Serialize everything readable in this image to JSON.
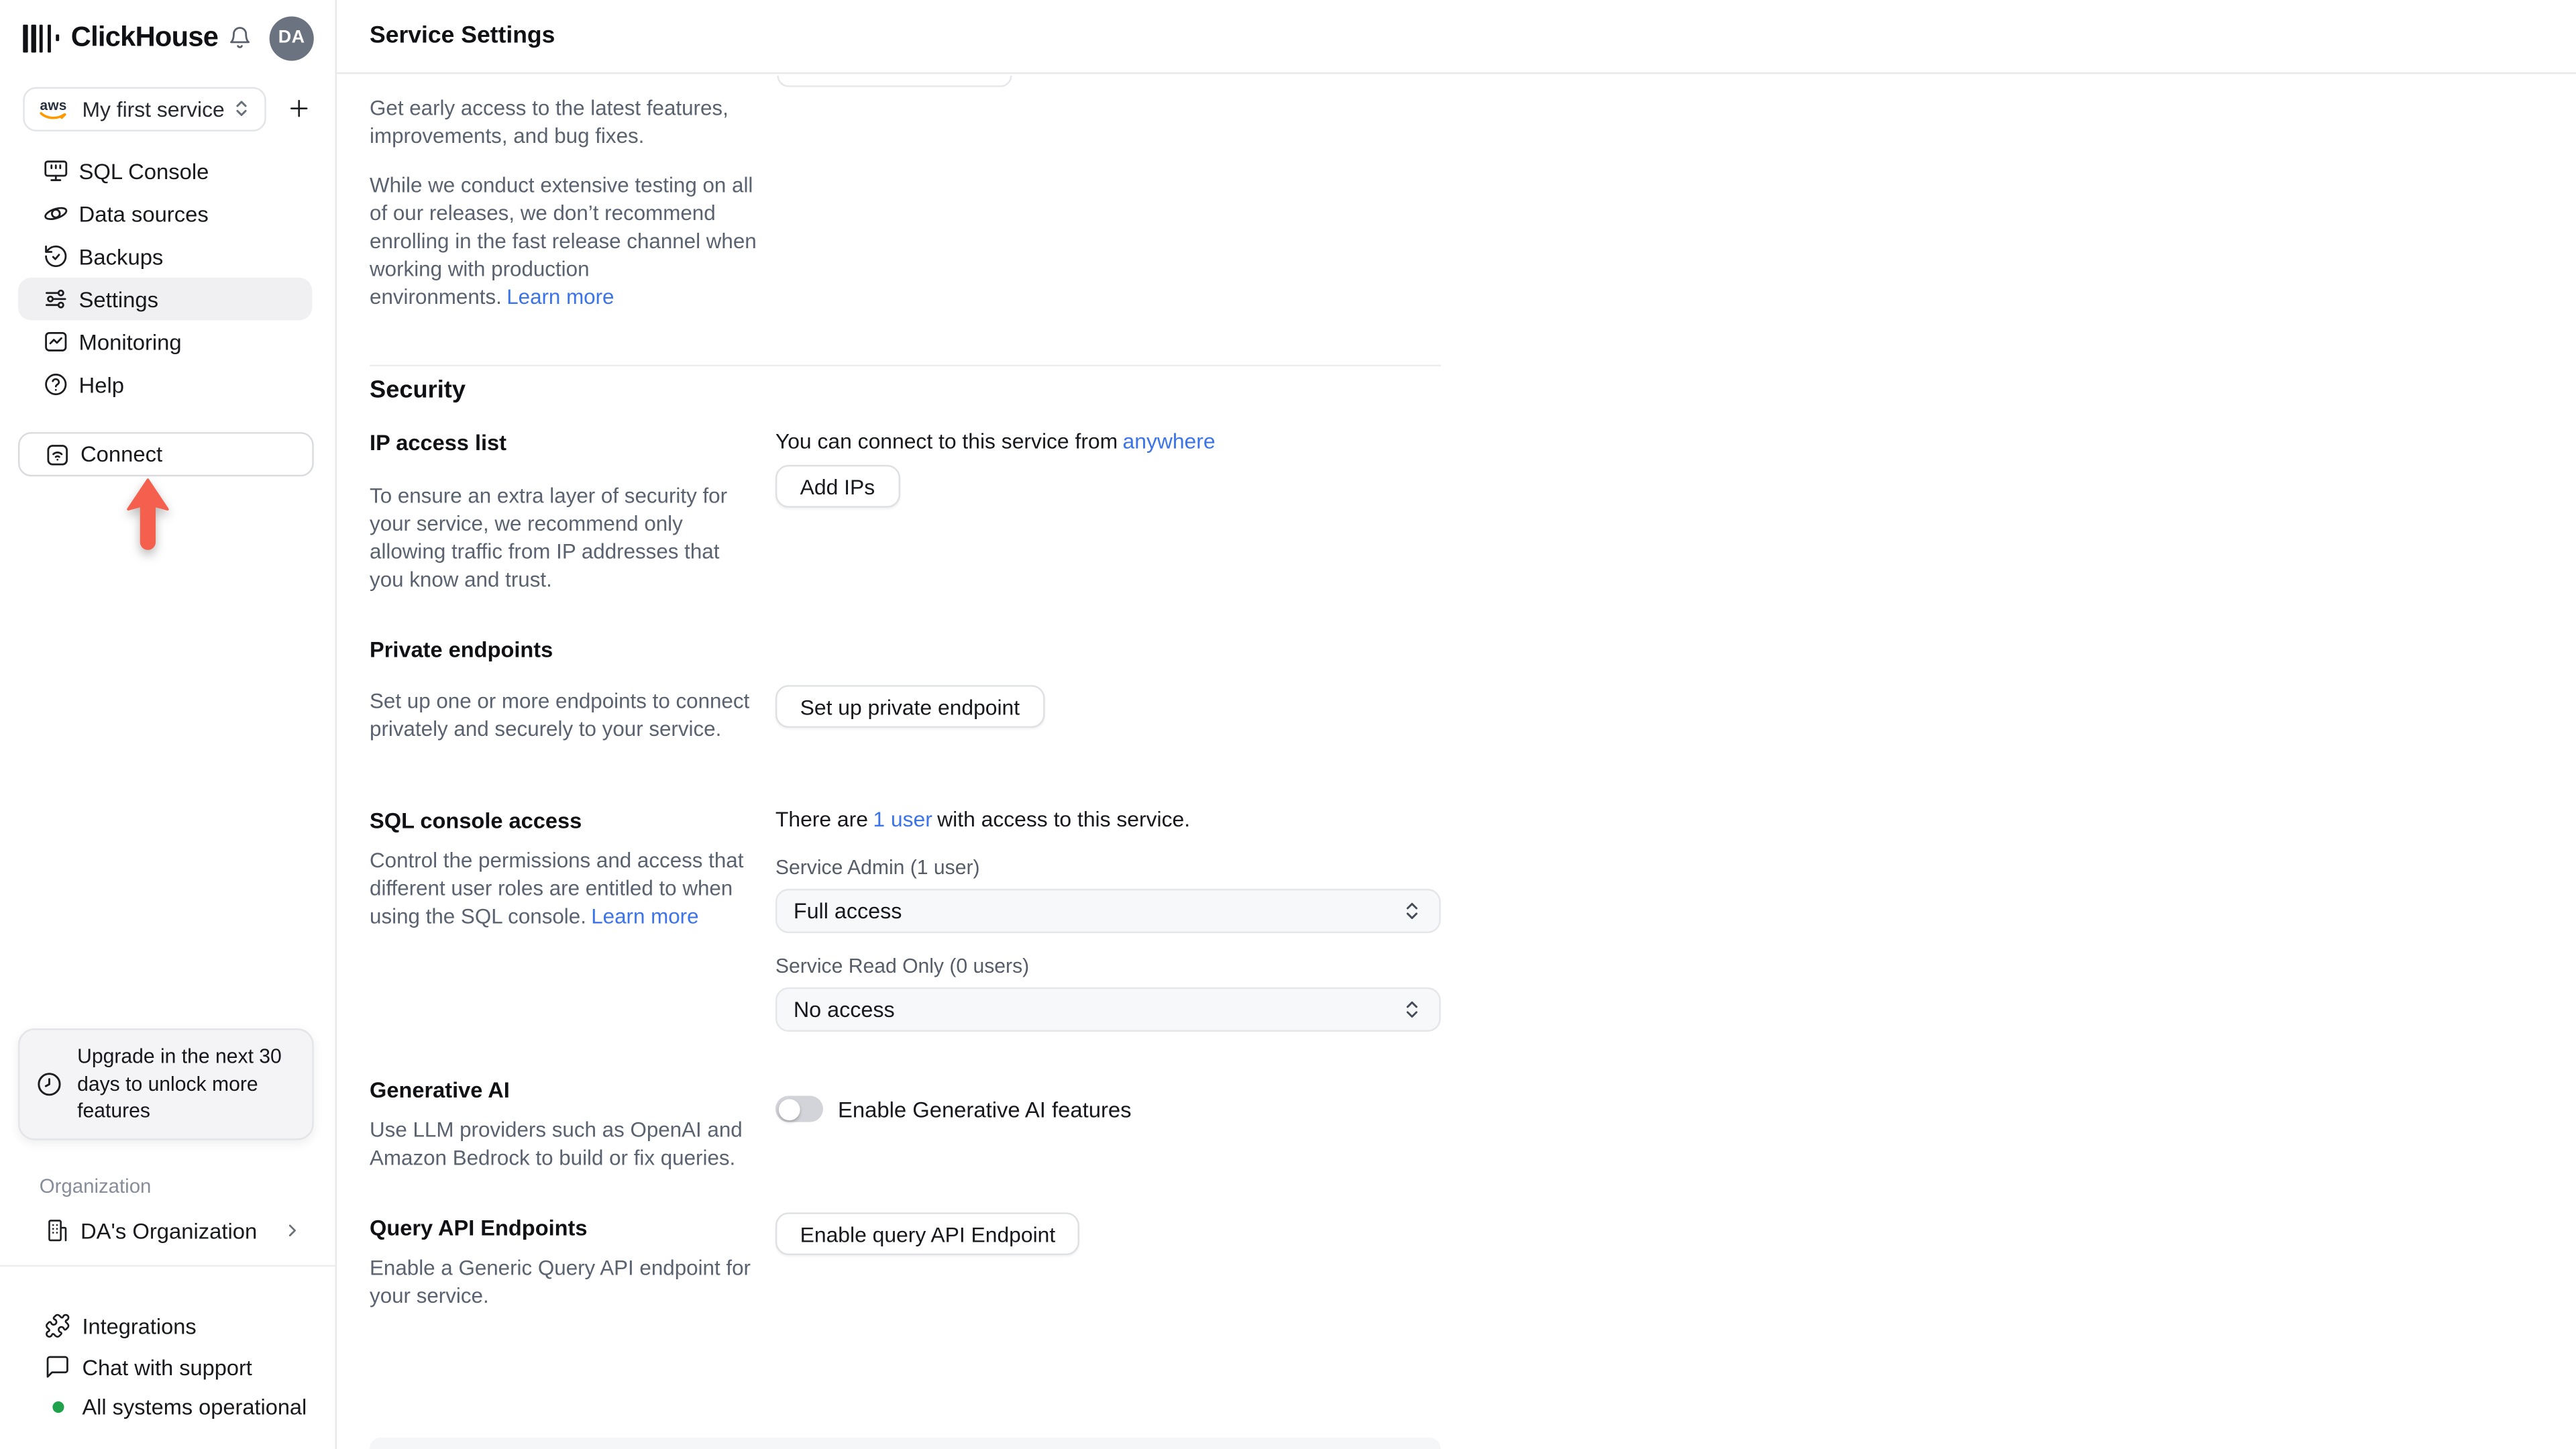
{
  "header": {
    "brand": "ClickHouse",
    "avatar": "DA"
  },
  "sidebar": {
    "service_selector": {
      "provider": "aws",
      "label": "My first service"
    },
    "nav": [
      {
        "icon": "sql-console-icon",
        "label": "SQL Console"
      },
      {
        "icon": "data-sources-icon",
        "label": "Data sources"
      },
      {
        "icon": "backups-icon",
        "label": "Backups"
      },
      {
        "icon": "settings-icon",
        "label": "Settings",
        "active": true
      },
      {
        "icon": "monitoring-icon",
        "label": "Monitoring"
      },
      {
        "icon": "help-icon",
        "label": "Help"
      }
    ],
    "connect_label": "Connect",
    "upgrade_note": "Upgrade in the next 30 days to unlock more features",
    "organization_label": "Organization",
    "organization_name": "DA's Organization",
    "footer": [
      {
        "icon": "integrations-icon",
        "label": "Integrations"
      },
      {
        "icon": "chat-icon",
        "label": "Chat with support"
      },
      {
        "icon": "status-dot",
        "label": "All systems operational"
      }
    ]
  },
  "main": {
    "title": "Service Settings",
    "release": {
      "p1": "Get early access to the latest features, improvements, and bug fixes.",
      "p2": "While we conduct extensive testing on all of our releases, we don’t recommend enrolling in the fast release channel when working with production environments.",
      "learn_more": "Learn more"
    },
    "security": {
      "heading": "Security",
      "ip_access": {
        "title": "IP access list",
        "description": "To ensure an extra layer of security for your service, we recommend only allowing traffic from IP addresses that you know and trust.",
        "connect_prefix": "You can connect to this service from",
        "connect_link": "anywhere",
        "button": "Add IPs"
      },
      "private_endpoints": {
        "title": "Private endpoints",
        "description": "Set up one or more endpoints to connect privately and securely to your service.",
        "button": "Set up private endpoint"
      },
      "sql_console_access": {
        "title": "SQL console access",
        "description": "Control the permissions and access that different user roles are entitled to when using the SQL console.",
        "learn_more": "Learn more",
        "users_prefix": "There are",
        "users_link": "1 user",
        "users_suffix": "with access to this service.",
        "admin_label": "Service Admin (1 user)",
        "admin_value": "Full access",
        "readonly_label": "Service Read Only (0 users)",
        "readonly_value": "No access"
      },
      "generative_ai": {
        "title": "Generative AI",
        "description": "Use LLM providers such as OpenAI and Amazon Bedrock to build or fix queries.",
        "toggle_label": "Enable Generative AI features",
        "toggle_state": "off"
      },
      "query_api": {
        "title": "Query API Endpoints",
        "description": "Enable a Generic Query API endpoint for your service.",
        "button": "Enable query API Endpoint"
      }
    }
  },
  "colors": {
    "link": "#3b73e8",
    "arrow_red": "#f4604d",
    "status_green": "#1fa34a",
    "avatar_bg": "#6b7280",
    "aws_orange": "#ff9900",
    "active_item_bg": "#f0f0f2"
  }
}
